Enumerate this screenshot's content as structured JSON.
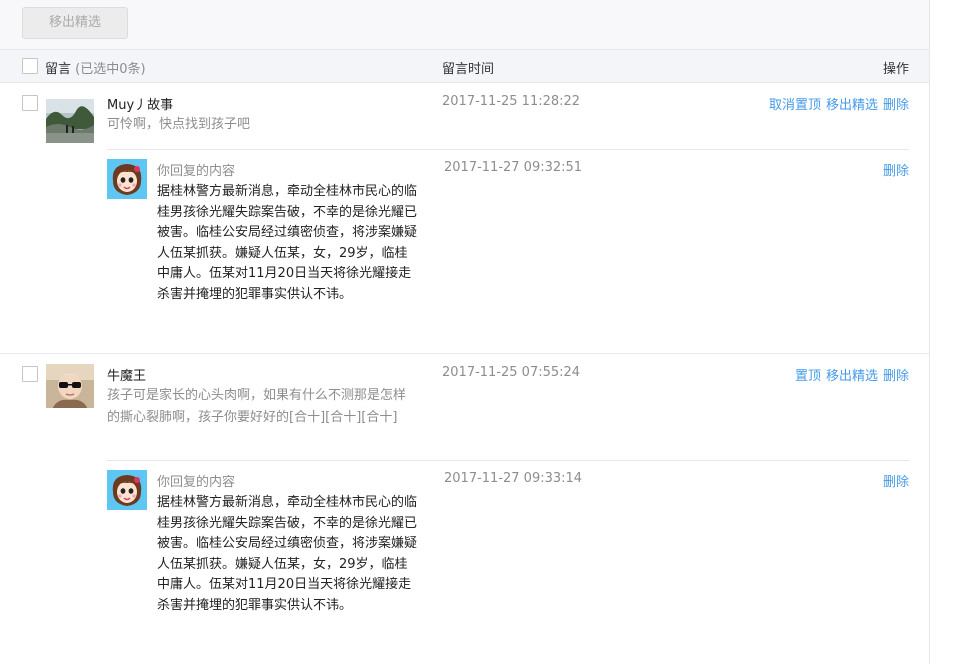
{
  "toolbar": {
    "remove_featured_label": "移出精选"
  },
  "table_header": {
    "message_label": "留言",
    "selected_count": "(已选中0条)",
    "time_label": "留言时间",
    "actions_label": "操作"
  },
  "comments": [
    {
      "user": "Muy丿故事",
      "text": "可怜啊，快点找到孩子吧",
      "time": "2017-11-25 11:28:22",
      "actions": [
        "取消置顶",
        "移出精选",
        "删除"
      ],
      "reply": {
        "label": "你回复的内容",
        "text": "据桂林警方最新消息，牵动全桂林市民心的临桂男孩徐光耀失踪案告破，不幸的是徐光耀已被害。临桂公安局经过缜密侦查，将涉案嫌疑人伍某抓获。嫌疑人伍某，女，29岁，临桂中庸人。伍某对11月20日当天将徐光耀接走杀害并掩埋的犯罪事实供认不讳。",
        "time": "2017-11-27 09:32:51",
        "delete_label": "删除"
      }
    },
    {
      "user": "牛魔王",
      "text": "孩子可是家长的心头肉啊，如果有什么不测那是怎样的撕心裂肺啊，孩子你要好好的[合十][合十][合十]",
      "time": "2017-11-25 07:55:24",
      "actions": [
        "置顶",
        "移出精选",
        "删除"
      ],
      "reply": {
        "label": "你回复的内容",
        "text": "据桂林警方最新消息，牵动全桂林市民心的临桂男孩徐光耀失踪案告破，不幸的是徐光耀已被害。临桂公安局经过缜密侦查，将涉案嫌疑人伍某抓获。嫌疑人伍某，女，29岁，临桂中庸人。伍某对11月20日当天将徐光耀接走杀害并掩埋的犯罪事实供认不讳。",
        "time": "2017-11-27 09:33:14",
        "delete_label": "删除"
      }
    }
  ],
  "colors": {
    "link": "#459ae9",
    "muted": "#8d8d8d",
    "border": "#e7e7eb"
  }
}
